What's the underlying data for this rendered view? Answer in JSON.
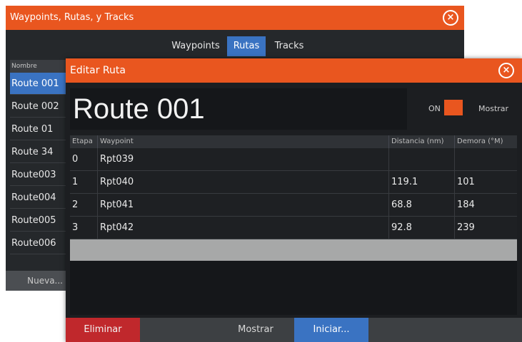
{
  "back_window": {
    "title": "Waypoints, Rutas, y Tracks",
    "tabs": [
      "Waypoints",
      "Rutas",
      "Tracks"
    ],
    "active_tab": "Rutas",
    "list_header": "Nombre",
    "routes": [
      "Route 001",
      "Route 002",
      "Route 01",
      "Route 34",
      "Route003",
      "Route004",
      "Route005",
      "Route006"
    ],
    "new_button": "Nueva..."
  },
  "dialog": {
    "title": "Editar Ruta",
    "route_name": "Route 001",
    "toggle_label": "ON",
    "show_label": "Mostrar",
    "columns": [
      "Etapa",
      "Waypoint",
      "Distancia (nm)",
      "Demora (°M)"
    ],
    "rows": [
      {
        "stage": "0",
        "waypoint": "Rpt039",
        "distance": "",
        "bearing": ""
      },
      {
        "stage": "1",
        "waypoint": "Rpt040",
        "distance": "119.1",
        "bearing": "101"
      },
      {
        "stage": "2",
        "waypoint": "Rpt041",
        "distance": "68.8",
        "bearing": "184"
      },
      {
        "stage": "3",
        "waypoint": "Rpt042",
        "distance": "92.8",
        "bearing": "239"
      }
    ],
    "buttons": {
      "delete": "Eliminar",
      "show": "Mostrar",
      "start": "Iniciar..."
    }
  },
  "colors": {
    "accent": "#e9561f",
    "selected": "#3a73c2",
    "delete": "#c0282c"
  }
}
